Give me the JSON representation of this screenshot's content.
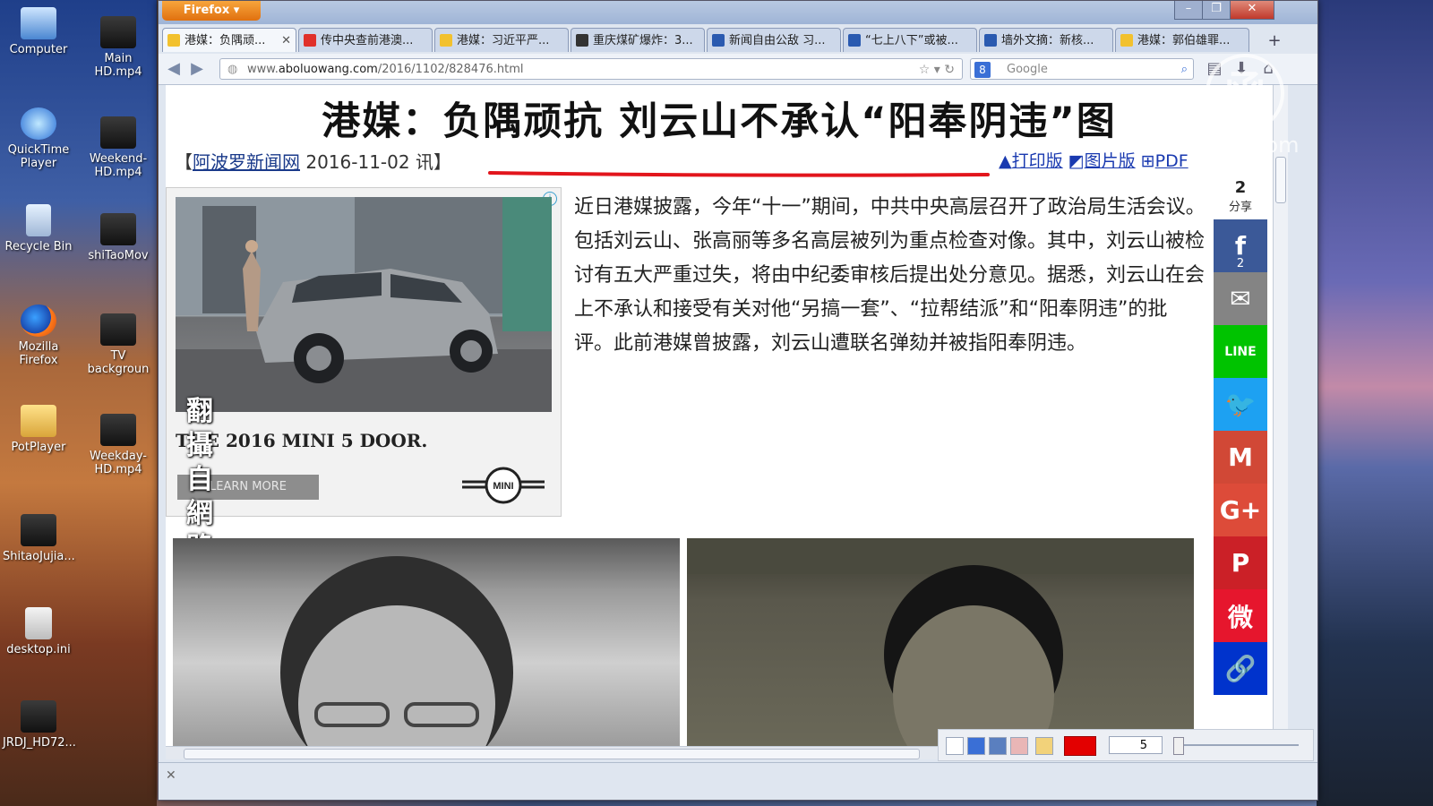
{
  "desktop": {
    "icons": [
      {
        "label": "Computer",
        "icon": "computer-icon"
      },
      {
        "label": "Main\nHD.mp4",
        "icon": "video-file-icon"
      },
      {
        "label": "QuickTime\nPlayer",
        "icon": "quicktime-icon"
      },
      {
        "label": "Weekend-\nHD.mp4",
        "icon": "video-file-icon"
      },
      {
        "label": "Recycle Bin",
        "icon": "recycle-bin-icon"
      },
      {
        "label": "shiTaoMov",
        "icon": "video-file-icon"
      },
      {
        "label": "Mozilla\nFirefox",
        "icon": "firefox-icon"
      },
      {
        "label": "TV\nbackgroun",
        "icon": "video-file-icon"
      },
      {
        "label": "PotPlayer",
        "icon": "folder-icon"
      },
      {
        "label": "Weekday-\nHD.mp4",
        "icon": "video-file-icon"
      },
      {
        "label": "ShitaoJujia...",
        "icon": "video-file-icon"
      },
      {
        "label": "desktop.ini",
        "icon": "ini-file-icon"
      },
      {
        "label": "JRDJ_HD72...",
        "icon": "video-file-icon"
      }
    ]
  },
  "browser": {
    "app_button": "Firefox ▾",
    "tabs": [
      {
        "label": "港媒：负隅顽...",
        "active": true,
        "icon_color": "#f2c12e"
      },
      {
        "label": "传中央查前港澳...",
        "active": false,
        "icon_color": "#e0302a"
      },
      {
        "label": "港媒：习近平严...",
        "active": false,
        "icon_color": "#f2c12e"
      },
      {
        "label": "重庆煤矿爆炸：3...",
        "active": false,
        "icon_color": "#333333"
      },
      {
        "label": "新闻自由公敌 习...",
        "active": false,
        "icon_color": "#2a5ab0"
      },
      {
        "label": "“七上八下”或被...",
        "active": false,
        "icon_color": "#2a5ab0"
      },
      {
        "label": "墙外文摘：新核...",
        "active": false,
        "icon_color": "#2a5ab0"
      },
      {
        "label": "港媒：郭伯雄罪...",
        "active": false,
        "icon_color": "#f2c12e"
      }
    ],
    "url_prefix": "www.",
    "url_domain": "aboluowang.com",
    "url_path": "/2016/1102/828476.html",
    "search_placeholder": "Google"
  },
  "article": {
    "headline": "港媒：负隅顽抗 刘云山不承认“阳奉阴违”图",
    "source_open": "【",
    "source_name": "阿波罗新闻网",
    "source_date": "2016-11-02 讯】",
    "print_version": "打印版",
    "image_version": "图片版",
    "pdf": "PDF",
    "body": "近日港媒披露，今年“十一”期间，中共中央高层召开了政治局生活会议。包括刘云山、张高丽等多名高层被列为重点检查对像。其中，刘云山被检讨有五大严重过失，将由中纪委审核后提出处分意见。据悉，刘云山在会上不承认和接受有关对他“另搞一套”、“拉帮结派”和“阳奉阴违”的批评。此前港媒曾披露，刘云山遭联名弹劾并被指阳奉阴违。",
    "ad": {
      "title": "THE 2016 MINI 5 DOOR.",
      "button": "LEARN MORE",
      "logo": "MINI"
    },
    "overlay_note": "翻攝自網路"
  },
  "share": {
    "count": "2",
    "label": "分享",
    "facebook_count": "2",
    "buttons": [
      {
        "name": "facebook",
        "glyph": "f",
        "color": "#3b5998"
      },
      {
        "name": "email",
        "glyph": "✉",
        "color": "#848484"
      },
      {
        "name": "line",
        "glyph": "LINE",
        "color": "#00c300"
      },
      {
        "name": "twitter",
        "glyph": "🐦",
        "color": "#1da1f2"
      },
      {
        "name": "gmail",
        "glyph": "M",
        "color": "#d14836"
      },
      {
        "name": "google-plus",
        "glyph": "G+",
        "color": "#dd4b39"
      },
      {
        "name": "pinterest",
        "glyph": "P",
        "color": "#cb2027"
      },
      {
        "name": "weibo",
        "glyph": "微",
        "color": "#e6162d"
      },
      {
        "name": "copy-link",
        "glyph": "🔗",
        "color": "#0033cc"
      }
    ]
  },
  "toolbox": {
    "size_value": "5",
    "color": "#e30000"
  },
  "watermark": {
    "seal": "函",
    "text": "ntdtv.com"
  }
}
